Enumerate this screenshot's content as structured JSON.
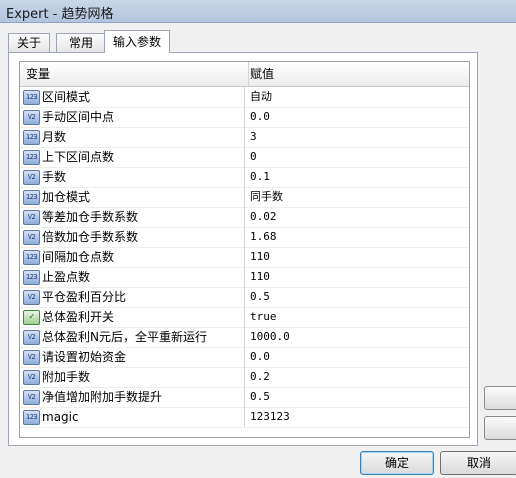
{
  "window": {
    "title": "Expert - 趋势网格"
  },
  "tabs": [
    {
      "label": "关于"
    },
    {
      "label": "常用"
    },
    {
      "label": "输入参数"
    }
  ],
  "grid": {
    "header_variable": "变量",
    "header_value": "赋值",
    "rows": [
      {
        "icon": "123",
        "name": "区间模式",
        "value": "自动"
      },
      {
        "icon": "V2",
        "name": "手动区间中点",
        "value": "0.0"
      },
      {
        "icon": "123",
        "name": "月数",
        "value": "3"
      },
      {
        "icon": "123",
        "name": "上下区间点数",
        "value": "0"
      },
      {
        "icon": "V2",
        "name": "手数",
        "value": "0.1"
      },
      {
        "icon": "123",
        "name": "加仓模式",
        "value": "同手数"
      },
      {
        "icon": "V2",
        "name": "等差加仓手数系数",
        "value": "0.02"
      },
      {
        "icon": "V2",
        "name": "倍数加仓手数系数",
        "value": "1.68"
      },
      {
        "icon": "123",
        "name": "间隔加仓点数",
        "value": "110"
      },
      {
        "icon": "123",
        "name": "止盈点数",
        "value": "110"
      },
      {
        "icon": "V2",
        "name": "平仓盈利百分比",
        "value": "0.5"
      },
      {
        "icon": "bool",
        "name": "总体盈利开关",
        "value": "true"
      },
      {
        "icon": "V2",
        "name": "总体盈利N元后，全平重新运行",
        "value": "1000.0"
      },
      {
        "icon": "V2",
        "name": "请设置初始资金",
        "value": "0.0"
      },
      {
        "icon": "V2",
        "name": "附加手数",
        "value": "0.2"
      },
      {
        "icon": "V2",
        "name": "净值增加附加手数提升",
        "value": "0.5"
      },
      {
        "icon": "123",
        "name": "magic",
        "value": "123123"
      }
    ]
  },
  "buttons": {
    "ok": "确定",
    "cancel": "取消"
  }
}
